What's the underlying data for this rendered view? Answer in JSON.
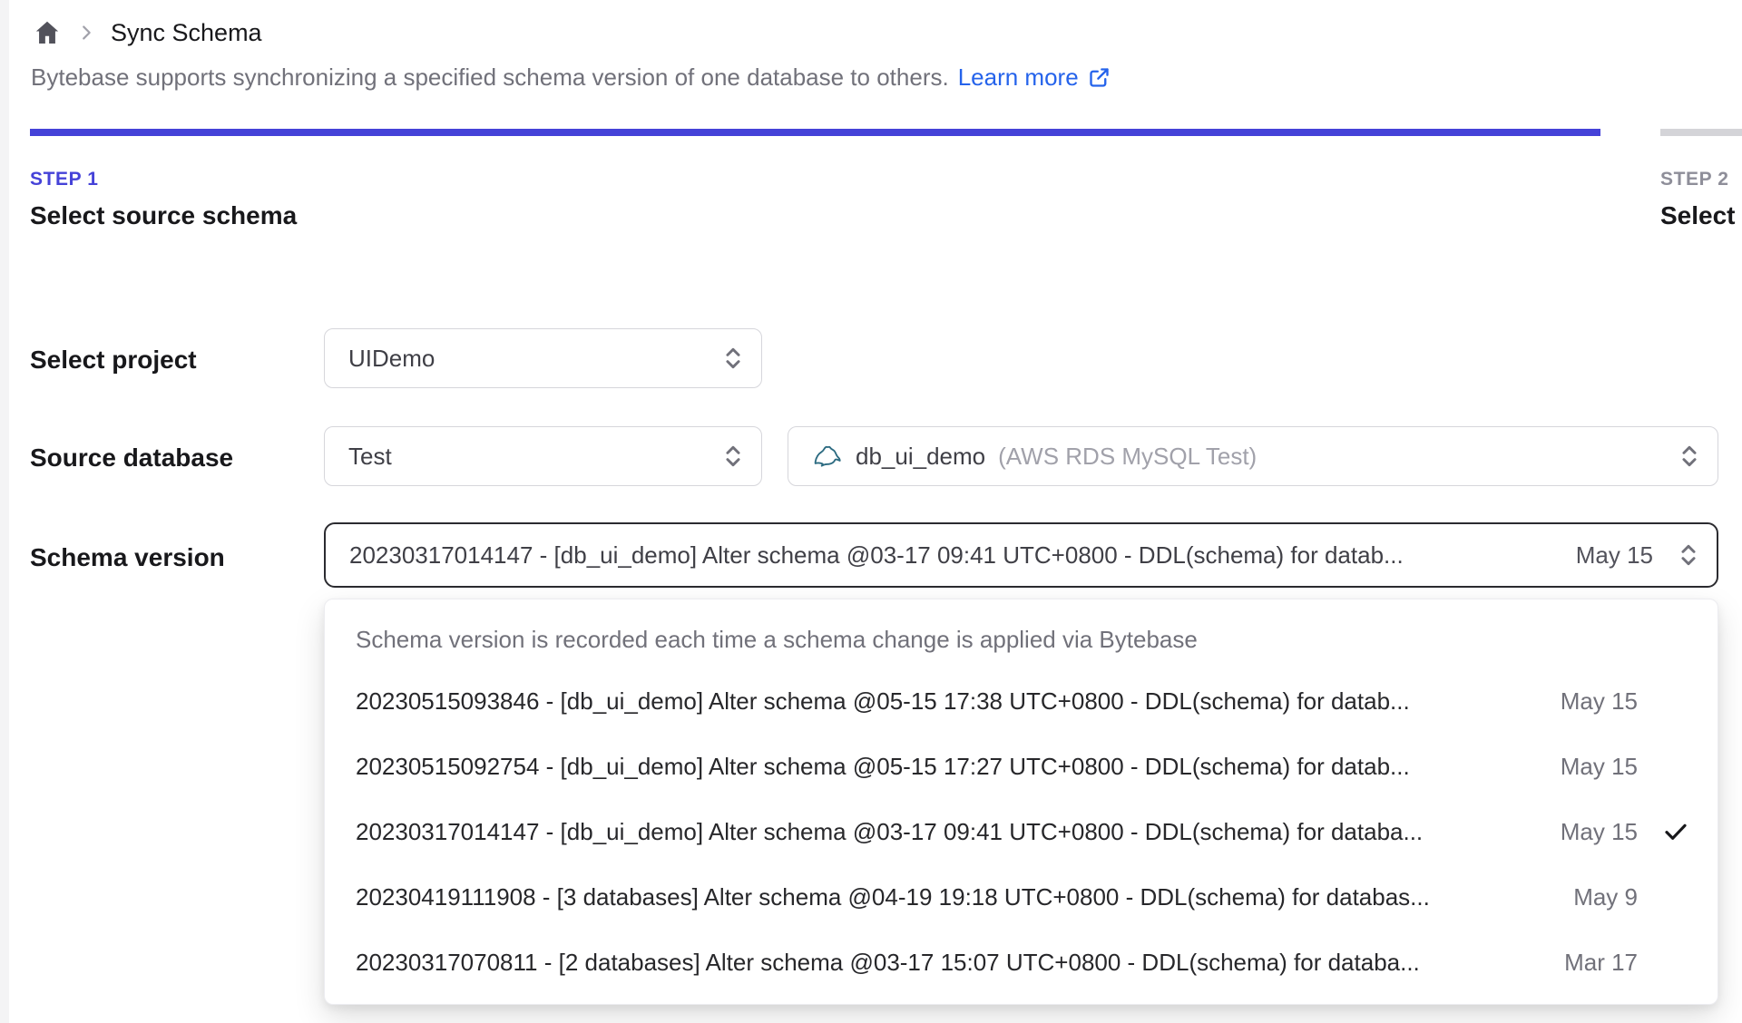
{
  "breadcrumb": {
    "page_title": "Sync Schema"
  },
  "header": {
    "description": "Bytebase supports synchronizing a specified schema version of one database to others.",
    "learn_more_label": "Learn more"
  },
  "steps": [
    {
      "step_label": "STEP 1",
      "title": "Select source schema",
      "state": "active"
    },
    {
      "step_label": "STEP 2",
      "title": "Select t",
      "state": "upcoming"
    }
  ],
  "form": {
    "project": {
      "label": "Select project",
      "value": "UIDemo"
    },
    "source_database": {
      "label": "Source database",
      "environment_value": "Test",
      "database_value": "db_ui_demo",
      "database_annotation": "(AWS RDS MySQL Test)",
      "database_icon": "mysql-icon"
    },
    "schema_version": {
      "label": "Schema version",
      "value": "20230317014147 - [db_ui_demo] Alter schema @03-17 09:41 UTC+0800 - DDL(schema) for datab...",
      "value_date": "May 15"
    }
  },
  "version_dropdown": {
    "hint": "Schema version is recorded each time a schema change is applied via Bytebase",
    "options": [
      {
        "text": "20230515093846 - [db_ui_demo] Alter schema @05-15 17:38 UTC+0800 - DDL(schema) for datab...",
        "date": "May 15",
        "selected": false
      },
      {
        "text": "20230515092754 - [db_ui_demo] Alter schema @05-15 17:27 UTC+0800 - DDL(schema) for datab...",
        "date": "May 15",
        "selected": false
      },
      {
        "text": "20230317014147 - [db_ui_demo] Alter schema @03-17 09:41 UTC+0800 - DDL(schema) for databa...",
        "date": "May 15",
        "selected": true
      },
      {
        "text": "20230419111908 - [3 databases] Alter schema @04-19 19:18 UTC+0800 - DDL(schema) for databas...",
        "date": "May 9",
        "selected": false
      },
      {
        "text": "20230317070811 - [2 databases] Alter schema @03-17 15:07 UTC+0800 - DDL(schema) for databa...",
        "date": "Mar 17",
        "selected": false
      }
    ]
  },
  "icons": {
    "home": "home-icon",
    "breadcrumb_separator": "chevron-right-icon",
    "external_link": "external-link-icon",
    "select_chevrons": "chevron-up-down-icon",
    "database_engine": "mysql-icon",
    "selected_mark": "check-icon"
  },
  "colors": {
    "accent_indigo": "#4542d8",
    "link_blue": "#2563eb",
    "inactive_bar_gray": "#d4d4d8",
    "focused_border": "#2b2b30",
    "muted_text": "#71717a"
  }
}
